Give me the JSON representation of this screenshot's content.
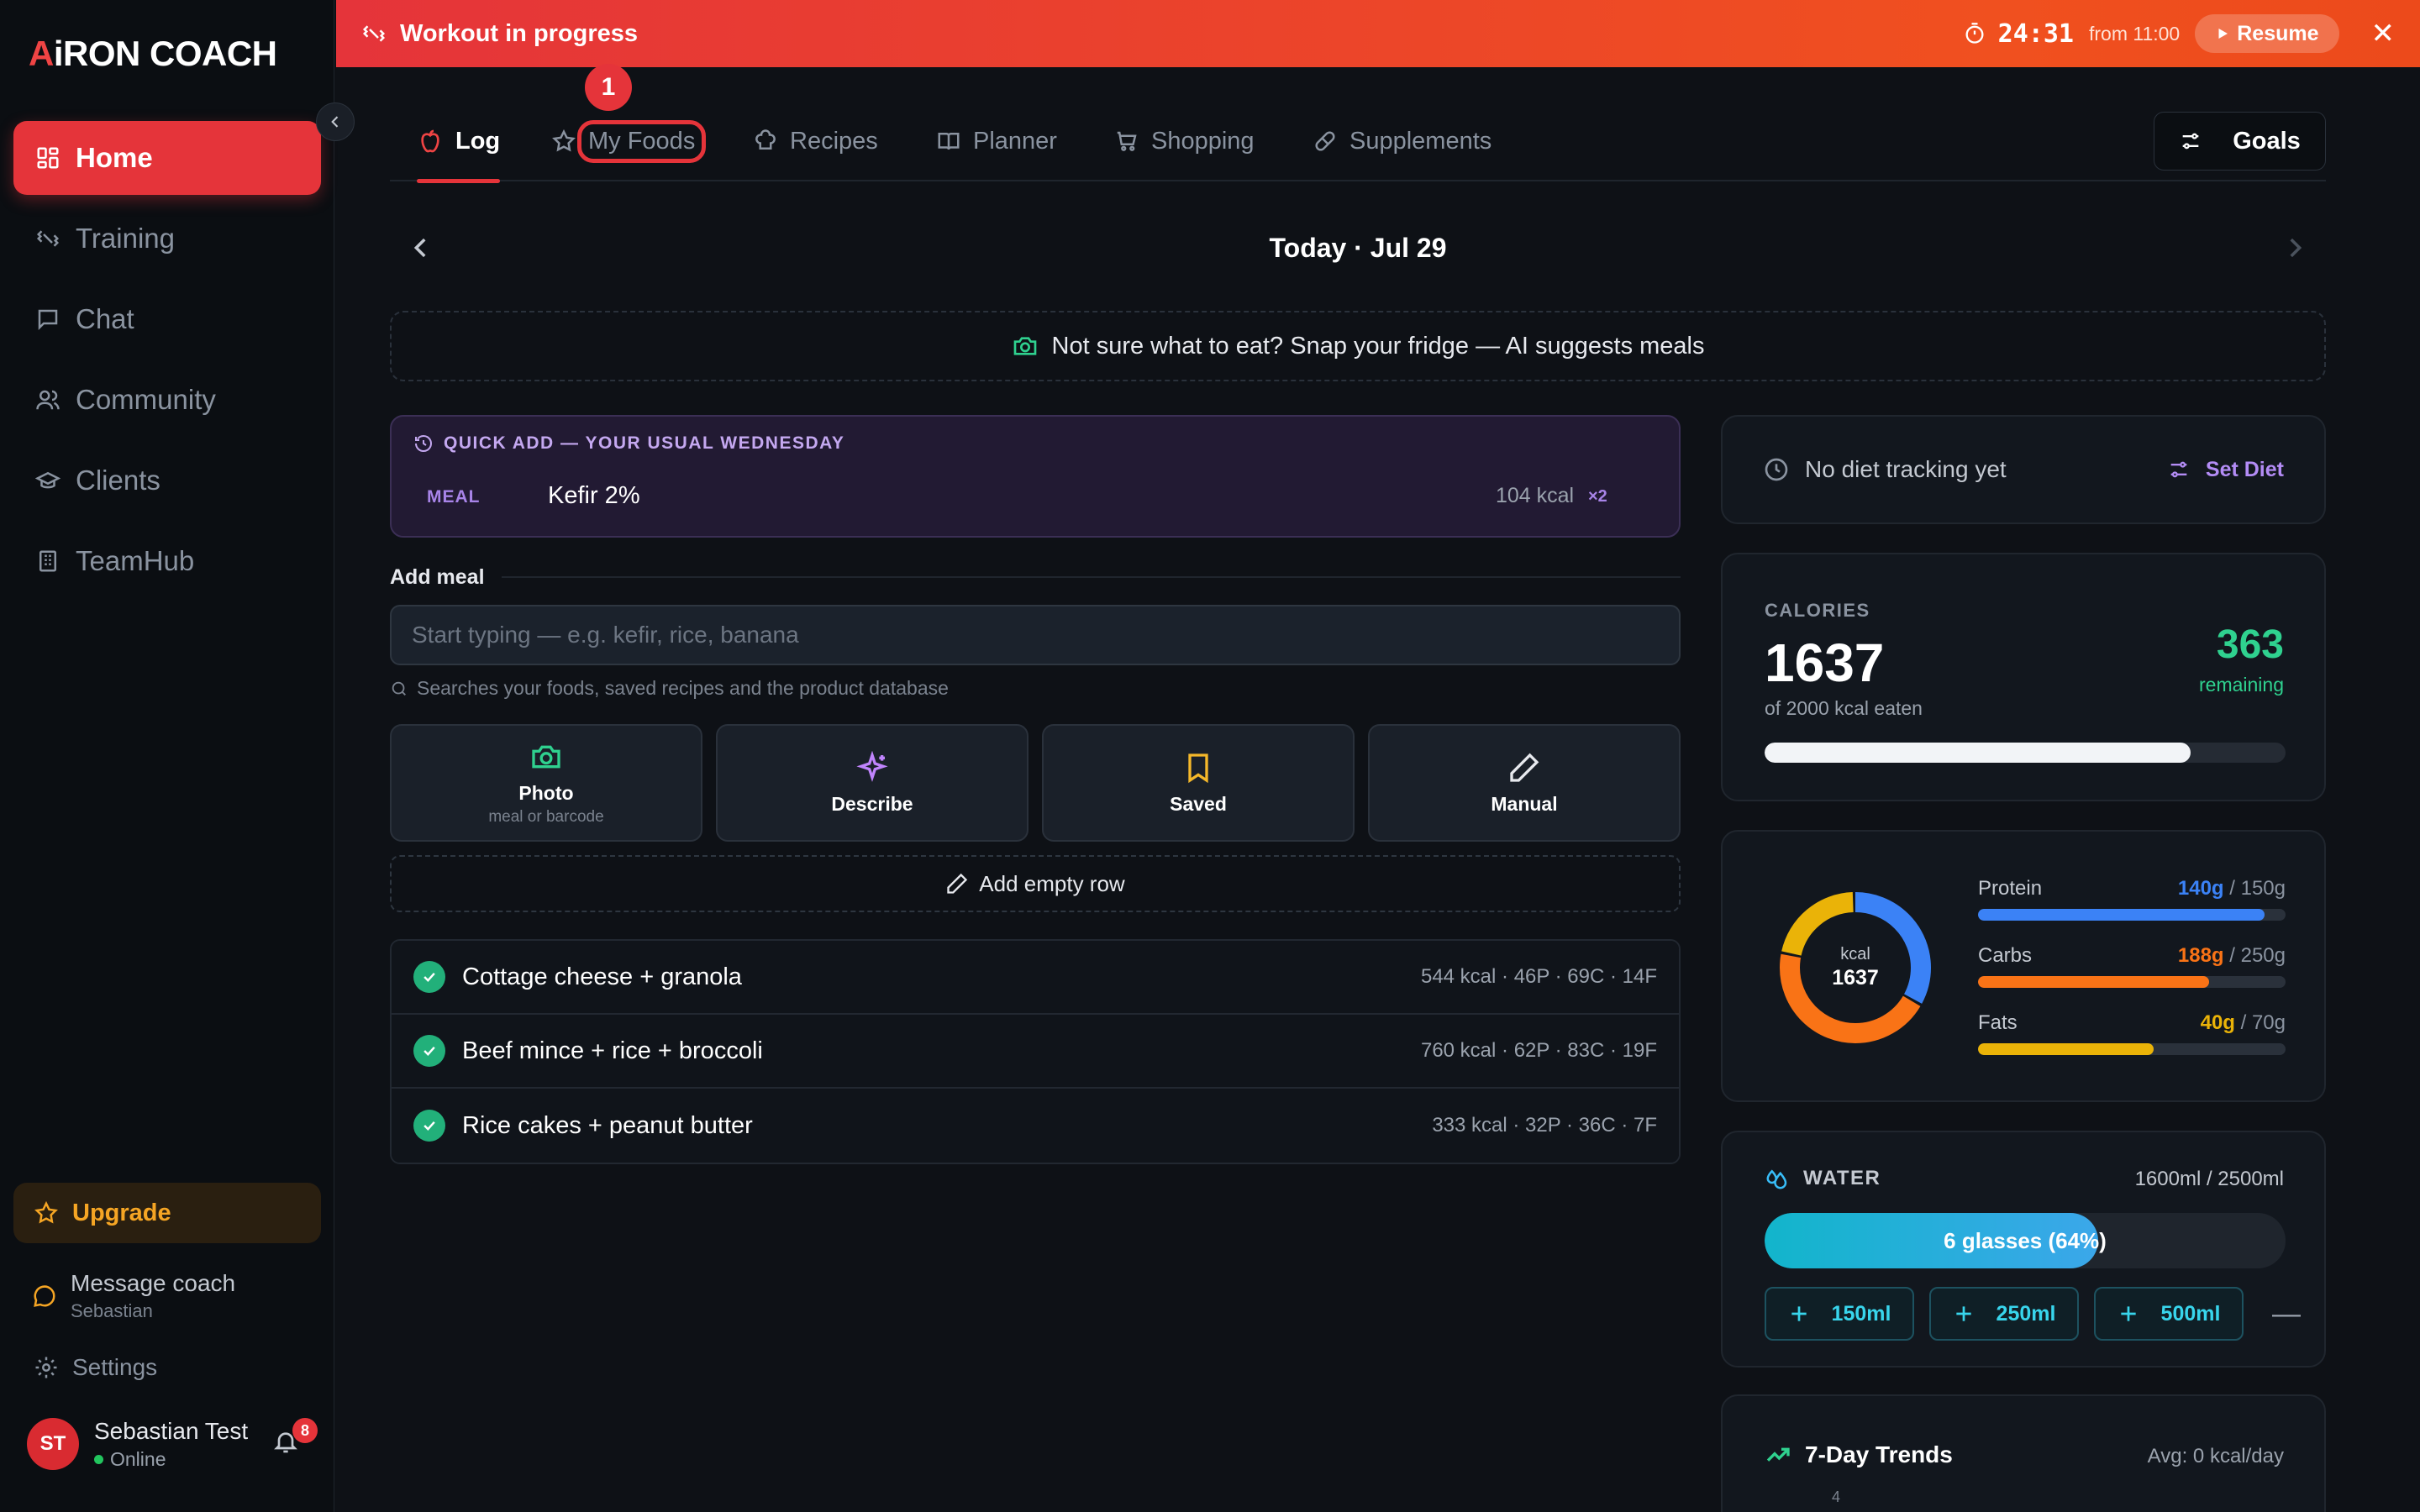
{
  "app": {
    "logo_a": "A",
    "logo_rest": "iRON COACH"
  },
  "sidebar": {
    "items": [
      {
        "label": "Home",
        "icon": "grid-icon"
      },
      {
        "label": "Training",
        "icon": "dumbbell-icon"
      },
      {
        "label": "Chat",
        "icon": "chat-icon"
      },
      {
        "label": "Community",
        "icon": "users-icon"
      },
      {
        "label": "Clients",
        "icon": "graduation-cap-icon"
      },
      {
        "label": "TeamHub",
        "icon": "building-icon"
      }
    ],
    "upgrade": "Upgrade",
    "message_coach": "Message coach",
    "coach_name": "Sebastian",
    "settings": "Settings",
    "user_initials": "ST",
    "user_name": "Sebastian Test",
    "user_status": "Online",
    "notifications": "8"
  },
  "banner": {
    "title": "Workout in progress",
    "timer": "24:31",
    "from": "from 11:00",
    "resume": "Resume",
    "close": "✕"
  },
  "tabs": [
    {
      "label": "Log",
      "icon": "apple-icon"
    },
    {
      "label": "My Foods",
      "icon": "star-icon"
    },
    {
      "label": "Recipes",
      "icon": "chef-hat-icon"
    },
    {
      "label": "Planner",
      "icon": "book-icon"
    },
    {
      "label": "Shopping",
      "icon": "cart-icon"
    },
    {
      "label": "Supplements",
      "icon": "pill-icon"
    }
  ],
  "marker": "1",
  "goals": "Goals",
  "date": "Today · Jul 29",
  "fridge": "Not sure what to eat? Snap your fridge — AI suggests meals",
  "quick_add": {
    "header": "QUICK ADD — YOUR USUAL WEDNESDAY",
    "meal_tag": "MEAL",
    "food": "Kefir 2%",
    "kcal": "104 kcal",
    "mult": "×2"
  },
  "add_meal": {
    "heading": "Add meal",
    "placeholder": "Start typing — e.g. kefir, rice, banana",
    "hint": "Searches your foods, saved recipes and the product database",
    "methods": [
      {
        "label": "Photo",
        "sub": "meal or barcode"
      },
      {
        "label": "Describe",
        "sub": ""
      },
      {
        "label": "Saved",
        "sub": ""
      },
      {
        "label": "Manual",
        "sub": ""
      }
    ],
    "empty_row": "Add empty row"
  },
  "meals": [
    {
      "name": "Cottage cheese + granola",
      "macros": "544 kcal · 46P · 69C · 14F"
    },
    {
      "name": "Beef mince + rice + broccoli",
      "macros": "760 kcal · 62P · 83C · 19F"
    },
    {
      "name": "Rice cakes + peanut butter",
      "macros": "333 kcal · 32P · 36C · 7F"
    }
  ],
  "diet": {
    "text": "No diet tracking yet",
    "action": "Set Diet"
  },
  "calories": {
    "label": "CALORIES",
    "eaten": "1637",
    "of": "of 2000 kcal eaten",
    "remaining": "363",
    "remaining_label": "remaining",
    "progress": 0.8185
  },
  "macros": {
    "donut_label": "kcal",
    "donut_value": "1637",
    "items": [
      {
        "name": "Protein",
        "value": "140g",
        "goal": " / 150g",
        "color": "#3b82f6",
        "progress": 0.933
      },
      {
        "name": "Carbs",
        "value": "188g",
        "goal": " / 250g",
        "color": "#f97316",
        "progress": 0.752
      },
      {
        "name": "Fats",
        "value": "40g",
        "goal": " / 70g",
        "color": "#eab308",
        "progress": 0.571
      }
    ]
  },
  "water": {
    "label": "WATER",
    "amount": "1600ml / 2500ml",
    "bar_text": "6 glasses (64%)",
    "progress": 0.64,
    "buttons": [
      "150ml",
      "250ml",
      "500ml"
    ],
    "minus": "—"
  },
  "trends": {
    "title": "7-Day Trends",
    "avg": "Avg: 0 kcal/day",
    "tick": "4"
  }
}
